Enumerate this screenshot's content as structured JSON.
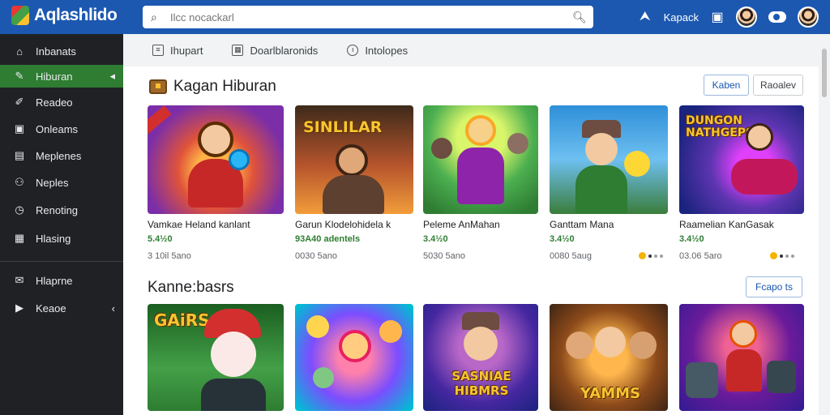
{
  "app": {
    "title": "Aqlashlido"
  },
  "search": {
    "placeholder": "Ilcc nocackarl",
    "value": ""
  },
  "header": {
    "right_label": "Kapack"
  },
  "sidebar": {
    "items": [
      {
        "label": "Inbanats",
        "icon": "home-icon"
      },
      {
        "label": "Hiburan",
        "icon": "pen-icon"
      },
      {
        "label": "Readeo",
        "icon": "wrench-icon"
      },
      {
        "label": "Onleams",
        "icon": "square-icon"
      },
      {
        "label": "Meplenes",
        "icon": "file-icon"
      },
      {
        "label": "Neples",
        "icon": "people-icon"
      },
      {
        "label": "Renoting",
        "icon": "clock-icon"
      },
      {
        "label": "Hlasing",
        "icon": "calendar-icon"
      },
      {
        "label": "Hlaprne",
        "icon": "mail-icon"
      },
      {
        "label": "Keaoe",
        "icon": "play-icon"
      }
    ]
  },
  "tabs": [
    {
      "label": "Ihupart",
      "icon": "doc-icon"
    },
    {
      "label": "Doarlblaronids",
      "icon": "grid-icon"
    },
    {
      "label": "Intolopes",
      "icon": "circle-icon"
    }
  ],
  "section1": {
    "title": "Kagan Hiburan",
    "button_primary": "Kaben",
    "button_secondary": "Raoalev"
  },
  "section2": {
    "title": "Kanne:basrs",
    "button": "Fcapo ts"
  },
  "cards1": [
    {
      "title": "Vamkae Heland kanlant",
      "rating": "5.4½0",
      "meta": "3 10il  5ano",
      "art_text": ""
    },
    {
      "title": "Garun Klodelohidela k",
      "rating": "93A40 adentels",
      "meta": "0030  5ano",
      "art_text": "SINLILAR"
    },
    {
      "title": "Peleme AnMahan",
      "rating": "3.4½0",
      "meta": "5030  5ano",
      "art_text": ""
    },
    {
      "title": "Ganttam Mana",
      "rating": "3.4½0",
      "meta": "0080  5aug",
      "art_text": ""
    },
    {
      "title": "Raamelian KanGasak",
      "rating": "3.4½0",
      "meta": "03.06  5aro",
      "art_text": "DUNGON NATHGEPS"
    }
  ],
  "cards2": [
    {
      "art_text": "GAiRS"
    },
    {
      "art_text": ""
    },
    {
      "art_text": "SASNIAE HIBMRS"
    },
    {
      "art_text": "YAMMS"
    },
    {
      "art_text": ""
    }
  ]
}
